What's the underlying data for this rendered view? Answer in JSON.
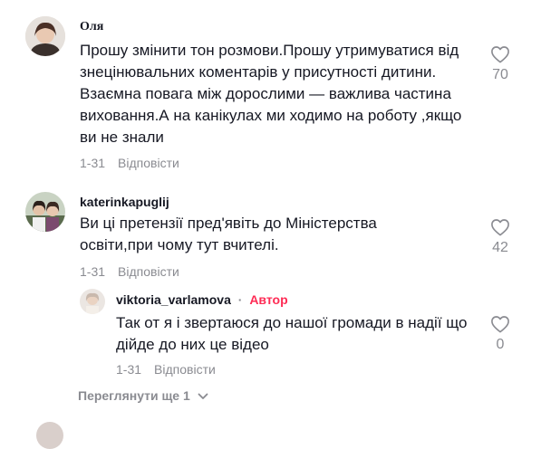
{
  "comments": [
    {
      "username": "Оля",
      "text": "Прошу змінити тон розмови.Прошу утримуватися від знецінювальних коментарів у присутності дитини. Взаємна повага між дорослими — важлива частина виховання.А на канікулах ми ходимо на роботу ,якщо ви не знали",
      "date": "1-31",
      "reply_label": "Відповісти",
      "like_count": "70"
    },
    {
      "username": "katerinkapuglij",
      "text": "Ви ці претензії пред'явіть до Міністерства освіти,при чому тут вчителі.",
      "date": "1-31",
      "reply_label": "Відповісти",
      "like_count": "42"
    }
  ],
  "reply": {
    "username": "viktoria_varlamova",
    "separator": "·",
    "author_tag": "Автор",
    "text": "Так от я і звертаюся до нашої громади в надії що дійде до них це відео",
    "date": "1-31",
    "reply_label": "Відповісти",
    "like_count": "0"
  },
  "view_more_label": "Переглянути ще 1",
  "colors": {
    "accent": "#fe2c55",
    "muted": "#8a8b91",
    "text": "#161823"
  }
}
